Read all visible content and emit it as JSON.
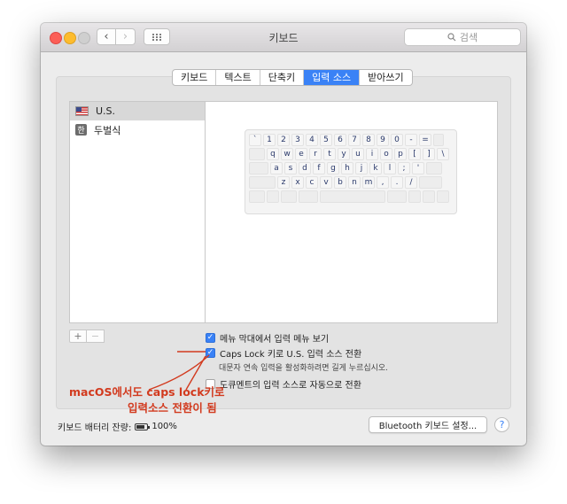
{
  "window": {
    "title": "키보드"
  },
  "toolbar": {
    "back_icon": "‹",
    "forward_icon": "›",
    "grid_icon": "⋮⋮⋮"
  },
  "search": {
    "placeholder": "검색"
  },
  "tabs": [
    {
      "label": "키보드",
      "active": false
    },
    {
      "label": "텍스트",
      "active": false
    },
    {
      "label": "단축키",
      "active": false
    },
    {
      "label": "입력 소스",
      "active": true
    },
    {
      "label": "받아쓰기",
      "active": false
    }
  ],
  "input_sources": [
    {
      "label": "U.S.",
      "icon": "us-flag-icon",
      "selected": true
    },
    {
      "label": "두벌식",
      "icon_text": "한",
      "selected": false
    }
  ],
  "keyboard_rows": [
    [
      "`",
      "1",
      "2",
      "3",
      "4",
      "5",
      "6",
      "7",
      "8",
      "9",
      "0",
      "-",
      "="
    ],
    [
      "q",
      "w",
      "e",
      "r",
      "t",
      "y",
      "u",
      "i",
      "o",
      "p",
      "[",
      "]",
      "\\"
    ],
    [
      "a",
      "s",
      "d",
      "f",
      "g",
      "h",
      "j",
      "k",
      "l",
      ";",
      "'"
    ],
    [
      "z",
      "x",
      "c",
      "v",
      "b",
      "n",
      "m",
      ",",
      ".",
      "/"
    ]
  ],
  "list_buttons": {
    "add": "+",
    "remove": "−"
  },
  "options": {
    "menu_bar": {
      "label": "메뉴 막대에서 입력 메뉴 보기",
      "checked": true
    },
    "caps_lock": {
      "label": "Caps Lock 키로 U.S. 입력 소스 전환",
      "checked": true,
      "hint": "대문자 연속 입력을 활성화하려면 길게 누르십시오."
    },
    "auto_switch": {
      "label": "도큐멘트의 입력 소스로 자동으로 전환",
      "checked": false
    }
  },
  "footer": {
    "battery_label": "키보드 배터리 잔량:",
    "battery_value": "100%",
    "bluetooth_button": "Bluetooth 키보드 설정...",
    "help": "?"
  },
  "annotation": {
    "line1": "macOS에서도 caps lock키로",
    "line2": "입력소스 전환이 됨",
    "color": "#d23a1e"
  },
  "colors": {
    "accent": "#3a82f6"
  }
}
